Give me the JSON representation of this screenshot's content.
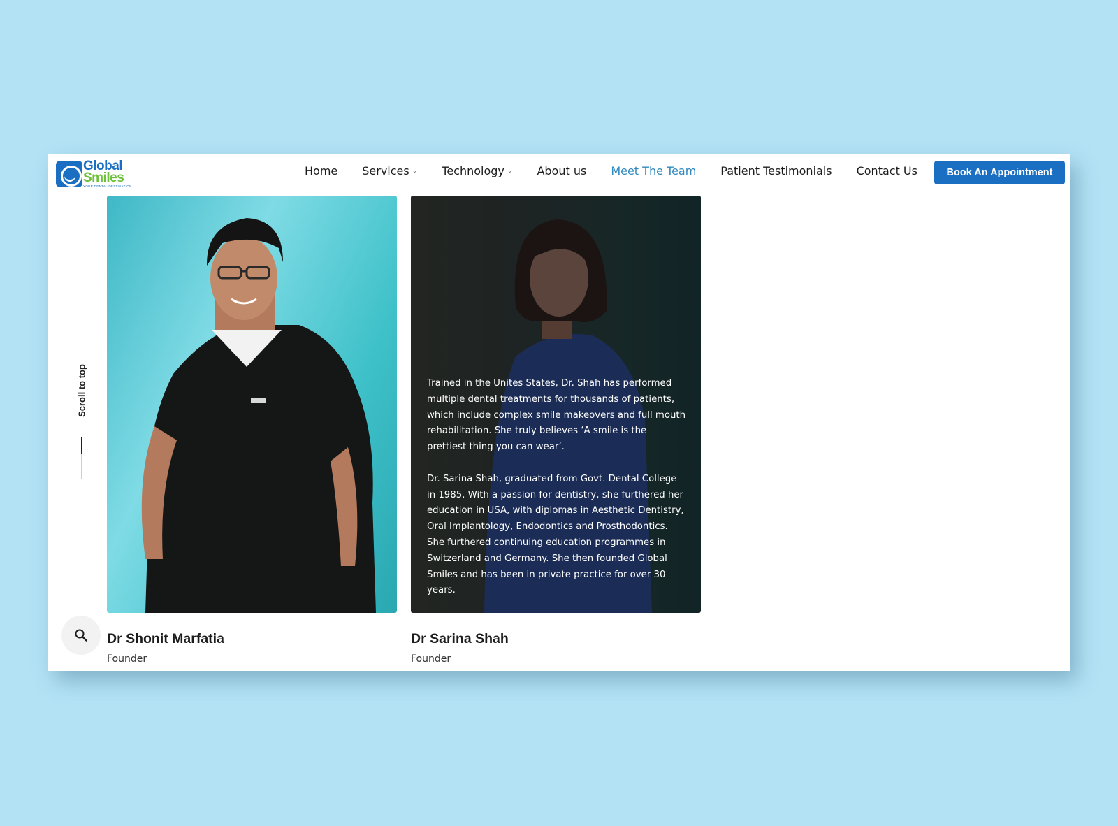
{
  "brand": {
    "name_line1": "Global",
    "name_line2": "Smiles",
    "tagline": "YOUR DENTAL DESTINATION"
  },
  "nav": {
    "items": [
      {
        "label": "Home",
        "has_dropdown": false,
        "active": false
      },
      {
        "label": "Services",
        "has_dropdown": true,
        "active": false
      },
      {
        "label": "Technology",
        "has_dropdown": true,
        "active": false
      },
      {
        "label": "About us",
        "has_dropdown": false,
        "active": false
      },
      {
        "label": "Meet The Team",
        "has_dropdown": false,
        "active": true
      },
      {
        "label": "Patient Testimonials",
        "has_dropdown": false,
        "active": false
      },
      {
        "label": "Contact Us",
        "has_dropdown": false,
        "active": false
      }
    ],
    "cta_label": "Book An Appointment"
  },
  "scroll_top_label": "Scroll to top",
  "icons": {
    "search": "search-icon",
    "dropdown": "chevron-down-icon"
  },
  "team": [
    {
      "name": "Dr Shonit Marfatia",
      "role": "Founder",
      "bio": []
    },
    {
      "name": "Dr Sarina Shah",
      "role": "Founder",
      "bio": [
        "Trained in the Unites States, Dr. Shah has performed multiple dental treatments for thousands of patients, which include complex smile makeovers and full mouth rehabilitation. She truly believes ‘A smile is the prettiest thing you can wear’.",
        "Dr. Sarina Shah, graduated from Govt. Dental College in 1985. With a passion for dentistry, she furthered her education in USA, with diplomas in Aesthetic Dentistry, Oral Implantology, Endodontics and Prosthodontics. She furthered continuing education programmes in Switzerland and Germany. She then founded Global Smiles and has been in private practice for over 30 years."
      ]
    }
  ],
  "colors": {
    "page_background": "#b3e2f5",
    "brand_blue": "#1b6fc2",
    "brand_green": "#6cc03a",
    "nav_active": "#2f88be"
  }
}
